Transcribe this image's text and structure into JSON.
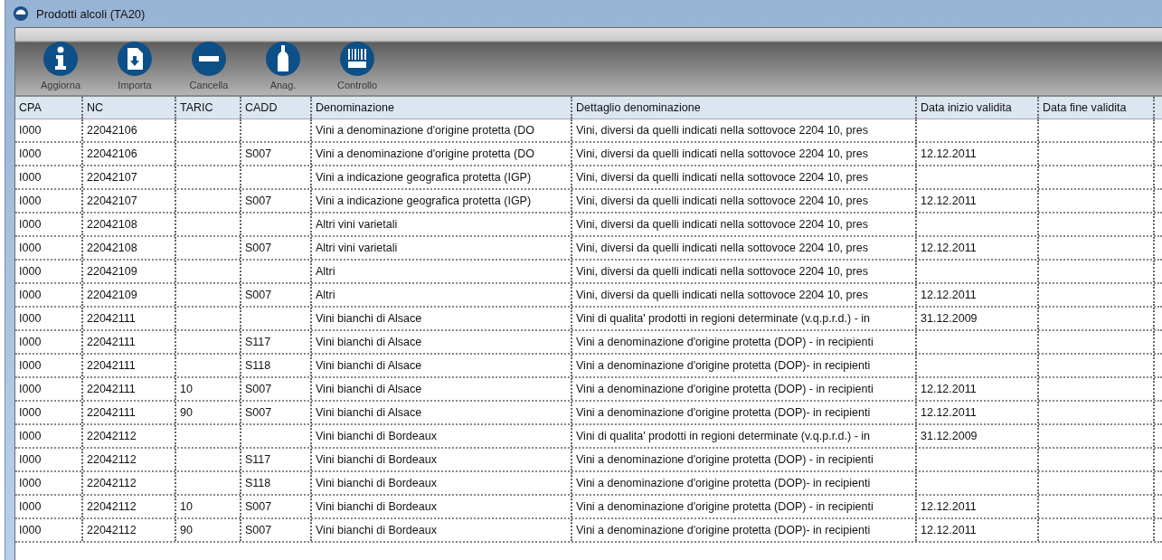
{
  "window": {
    "title": "Prodotti alcoli (TA20)"
  },
  "toolbar": [
    {
      "label": "Aggiorna",
      "kind": "info"
    },
    {
      "label": "Importa",
      "kind": "import"
    },
    {
      "label": "Cancella",
      "kind": "minus"
    },
    {
      "label": "Anag.",
      "kind": "bottle"
    },
    {
      "label": "Controllo",
      "kind": "barcode"
    }
  ],
  "table": {
    "columns": [
      "CPA",
      "NC",
      "TARIC",
      "CADD",
      "Denominazione",
      "Dettaglio denominazione",
      "Data inizio validita",
      "Data fine validita"
    ],
    "rows": [
      [
        "I000",
        "22042106",
        "",
        "",
        "Vini a denominazione d'origine protetta (DO",
        "Vini, diversi da quelli indicati nella sottovoce 2204 10, pres",
        "",
        ""
      ],
      [
        "I000",
        "22042106",
        "",
        "S007",
        "Vini a denominazione d'origine protetta (DO",
        "Vini, diversi da quelli indicati nella sottovoce 2204 10, pres",
        "12.12.2011",
        ""
      ],
      [
        "I000",
        "22042107",
        "",
        "",
        "Vini a indicazione geografica protetta (IGP)",
        "Vini, diversi da quelli indicati nella sottovoce 2204 10, pres",
        "",
        ""
      ],
      [
        "I000",
        "22042107",
        "",
        "S007",
        "Vini a indicazione geografica protetta (IGP)",
        "Vini, diversi da quelli indicati nella sottovoce 2204 10, pres",
        "12.12.2011",
        ""
      ],
      [
        "I000",
        "22042108",
        "",
        "",
        "Altri vini varietali",
        "Vini, diversi da quelli indicati nella sottovoce 2204 10, pres",
        "",
        ""
      ],
      [
        "I000",
        "22042108",
        "",
        "S007",
        "Altri vini varietali",
        "Vini, diversi da quelli indicati nella sottovoce 2204 10, pres",
        "12.12.2011",
        ""
      ],
      [
        "I000",
        "22042109",
        "",
        "",
        "Altri",
        "Vini, diversi da quelli indicati nella sottovoce 2204 10, pres",
        "",
        ""
      ],
      [
        "I000",
        "22042109",
        "",
        "S007",
        "Altri",
        "Vini, diversi da quelli indicati nella sottovoce 2204 10, pres",
        "12.12.2011",
        ""
      ],
      [
        "I000",
        "22042111",
        "",
        "",
        "Vini bianchi di Alsace",
        "Vini di qualita' prodotti in regioni determinate (v.q.p.r.d.) - in",
        "31.12.2009",
        ""
      ],
      [
        "I000",
        "22042111",
        "",
        "S117",
        "Vini bianchi di Alsace",
        "Vini a denominazione d'origine protetta (DOP) - in recipienti",
        "",
        ""
      ],
      [
        "I000",
        "22042111",
        "",
        "S118",
        "Vini bianchi di Alsace",
        "Vini a denominazione d'origine protetta (DOP)- in recipienti",
        "",
        ""
      ],
      [
        "I000",
        "22042111",
        "10",
        "S007",
        "Vini bianchi di Alsace",
        "Vini a denominazione d'origine protetta (DOP) - in recipienti",
        "12.12.2011",
        ""
      ],
      [
        "I000",
        "22042111",
        "90",
        "S007",
        "Vini bianchi di Alsace",
        "Vini a denominazione d'origine protetta (DOP)- in recipienti",
        "12.12.2011",
        ""
      ],
      [
        "I000",
        "22042112",
        "",
        "",
        "Vini bianchi di Bordeaux",
        "Vini di qualita' prodotti in regioni determinate (v.q.p.r.d.) - in",
        "31.12.2009",
        ""
      ],
      [
        "I000",
        "22042112",
        "",
        "S117",
        "Vini bianchi di Bordeaux",
        "Vini a denominazione d'origine protetta (DOP) - in recipienti",
        "",
        ""
      ],
      [
        "I000",
        "22042112",
        "",
        "S118",
        "Vini bianchi di Bordeaux",
        "Vini a denominazione d'origine protetta (DOP)- in recipienti",
        "",
        ""
      ],
      [
        "I000",
        "22042112",
        "10",
        "S007",
        "Vini bianchi di Bordeaux",
        "Vini a denominazione d'origine protetta (DOP) - in recipienti",
        "12.12.2011",
        ""
      ],
      [
        "I000",
        "22042112",
        "90",
        "S007",
        "Vini bianchi di Bordeaux",
        "Vini a denominazione d'origine protetta (DOP)- in recipienti",
        "12.12.2011",
        ""
      ]
    ]
  }
}
